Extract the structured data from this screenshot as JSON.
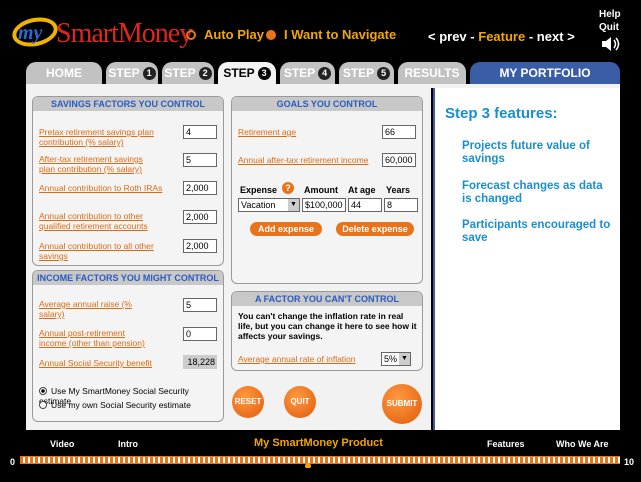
{
  "header": {
    "logo_my": "my",
    "logo_brand": "SmartMoney",
    "auto_play": "Auto Play",
    "want_navigate": "I Want to Navigate",
    "prev": "< prev",
    "feature": "Feature",
    "next": "next >",
    "help": "Help",
    "quit": "Quit"
  },
  "tabs": {
    "home": "HOME",
    "step1": "STEP",
    "step1_num": "1",
    "step2": "STEP",
    "step2_num": "2",
    "step3": "STEP",
    "step3_num": "3",
    "step4": "STEP",
    "step4_num": "4",
    "step5": "STEP",
    "step5_num": "5",
    "results": "RESULTS",
    "portfolio": "MY PORTFOLIO"
  },
  "savings": {
    "title": "SAVINGS FACTORS YOU CONTROL",
    "pretax_label": "Pretax retirement savings plan contribution (% salary)",
    "pretax_value": "4",
    "aftertax_label": "After-tax retirement savings plan contribution (% salary)",
    "aftertax_value": "5",
    "roth_label": "Annual contribution to Roth IRAs",
    "roth_value": "2,000",
    "other_qualified_label": "Annual contribution to other qualified retirement accounts",
    "other_qualified_value": "2,000",
    "other_savings_label": "Annual contribution to all other savings",
    "other_savings_value": "2,000"
  },
  "income": {
    "title": "INCOME FACTORS YOU MIGHT CONTROL",
    "raise_label": "Average annual raise (% salary)",
    "raise_value": "5",
    "post_ret_label": "Annual post-retirement income (other than pension)",
    "post_ret_value": "0",
    "ss_label": "Annual Social Security benefit",
    "ss_value": "18,228",
    "use_estimate": "Use My SmartMoney Social Security estimate",
    "use_own": "Use my own Social Security estimate"
  },
  "goals": {
    "title": "GOALS YOU CONTROL",
    "ret_age_label": "Retirement age",
    "ret_age_value": "66",
    "income_label": "Annual after-tax retirement income",
    "income_value": "60,000",
    "col_expense": "Expense",
    "col_amount": "Amount",
    "col_age": "At age",
    "col_years": "Years",
    "expense_value": "Vacation Hon",
    "amount_value": "$100,000",
    "age_value": "44",
    "years_value": "8",
    "add_expense": "Add expense",
    "delete_expense": "Delete expense"
  },
  "cant_control": {
    "title": "A FACTOR YOU CAN'T CONTROL",
    "body": "You can't change the inflation rate in real life, but you can change it here to see how it affects your savings.",
    "inflation_label": "Average annual rate of inflation",
    "inflation_value": "5%"
  },
  "buttons": {
    "reset": "RESET",
    "quit": "QUIT",
    "submit": "SUBMIT"
  },
  "features": {
    "title": "Step 3 features:",
    "items": [
      "Projects future value of savings",
      "Forecast changes as data is changed",
      "Participants encouraged to save"
    ]
  },
  "timeline": {
    "video": "Video",
    "intro": "Intro",
    "product": "My SmartMoney Product",
    "features": "Features",
    "who": "Who We Are",
    "start": "0",
    "end": "10",
    "progress": 0.48
  },
  "colors": {
    "accent": "#e8731a",
    "blue": "#1a8fd0",
    "portfolio": "#3a5ea6"
  }
}
